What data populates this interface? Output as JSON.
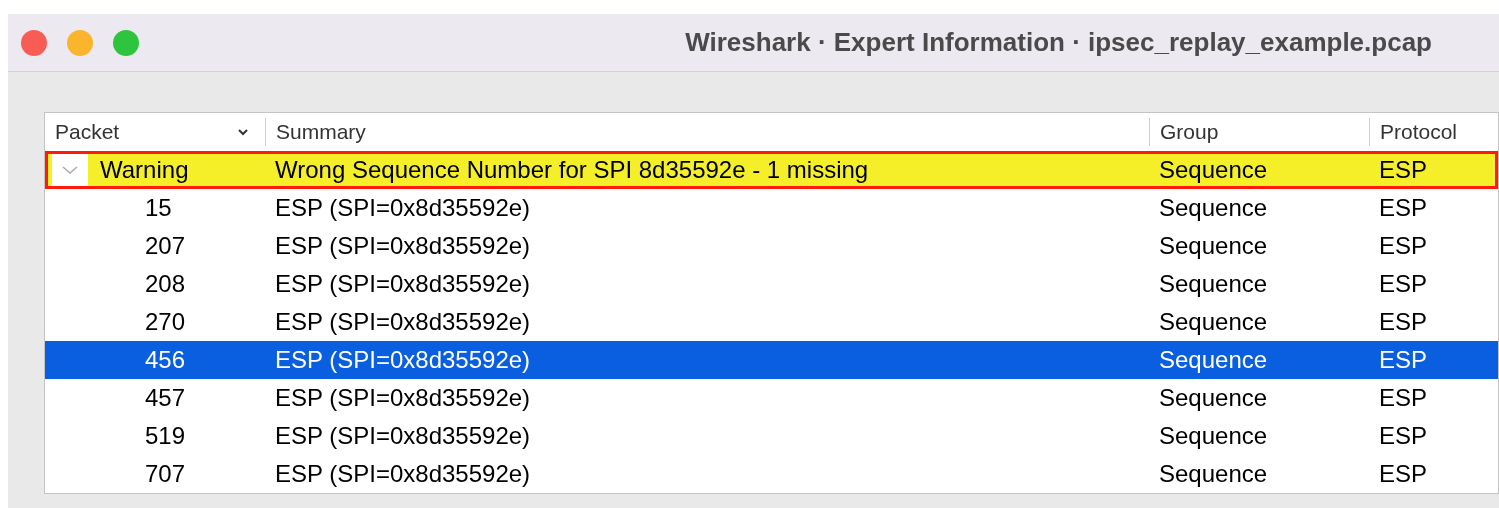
{
  "window": {
    "title": "Wireshark · Expert Information · ipsec_replay_example.pcap"
  },
  "table": {
    "columns": [
      "Packet",
      "Summary",
      "Group",
      "Protocol"
    ],
    "groups": [
      {
        "severity": "Warning",
        "summary": "Wrong Sequence Number for SPI 8d35592e - 1 missing",
        "group": "Sequence",
        "protocol": "ESP",
        "expanded": true,
        "children": [
          {
            "packet": "15",
            "summary": "ESP (SPI=0x8d35592e)",
            "group": "Sequence",
            "protocol": "ESP",
            "selected": false
          },
          {
            "packet": "207",
            "summary": "ESP (SPI=0x8d35592e)",
            "group": "Sequence",
            "protocol": "ESP",
            "selected": false
          },
          {
            "packet": "208",
            "summary": "ESP (SPI=0x8d35592e)",
            "group": "Sequence",
            "protocol": "ESP",
            "selected": false
          },
          {
            "packet": "270",
            "summary": "ESP (SPI=0x8d35592e)",
            "group": "Sequence",
            "protocol": "ESP",
            "selected": false
          },
          {
            "packet": "456",
            "summary": "ESP (SPI=0x8d35592e)",
            "group": "Sequence",
            "protocol": "ESP",
            "selected": true
          },
          {
            "packet": "457",
            "summary": "ESP (SPI=0x8d35592e)",
            "group": "Sequence",
            "protocol": "ESP",
            "selected": false
          },
          {
            "packet": "519",
            "summary": "ESP (SPI=0x8d35592e)",
            "group": "Sequence",
            "protocol": "ESP",
            "selected": false
          },
          {
            "packet": "707",
            "summary": "ESP (SPI=0x8d35592e)",
            "group": "Sequence",
            "protocol": "ESP",
            "selected": false
          }
        ]
      }
    ]
  }
}
